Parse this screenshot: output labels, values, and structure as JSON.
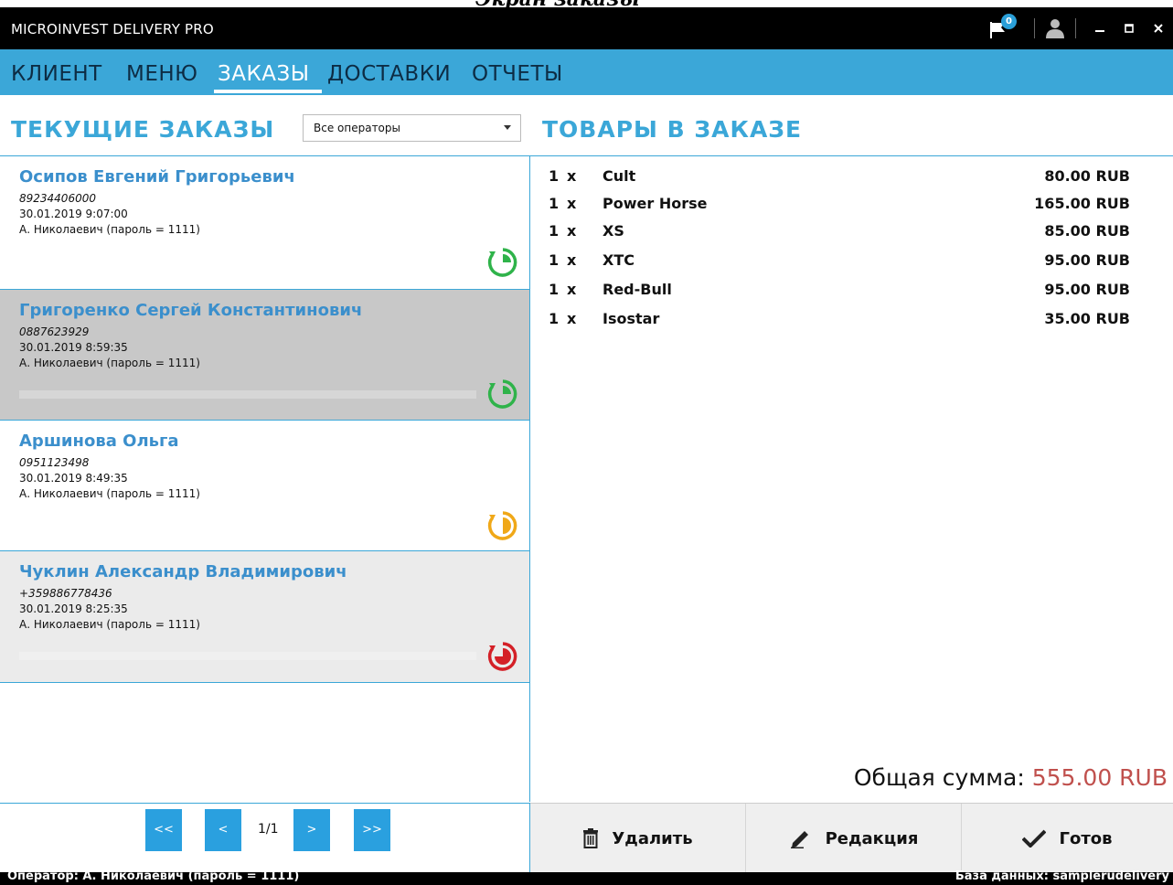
{
  "caption": "Экран заказы",
  "window": {
    "title": "MICROINVEST DELIVERY PRO",
    "notification_count": "0"
  },
  "menu": [
    {
      "label": "КЛИЕНТ",
      "active": false
    },
    {
      "label": "МЕНЮ",
      "active": false
    },
    {
      "label": "ЗАКАЗЫ",
      "active": true
    },
    {
      "label": "ДОСТАВКИ",
      "active": false
    },
    {
      "label": "ОТЧЕТЫ",
      "active": false
    }
  ],
  "orders_section": {
    "title": "ТЕКУЩИЕ ЗАКАЗЫ",
    "operator_filter": "Все операторы"
  },
  "orders": [
    {
      "name": "Осипов Евгений Григорьевич",
      "phone": "89234406000",
      "datetime": "30.01.2019 9:07:00",
      "operator": "А. Николаевич (пароль = 1111)",
      "status_color": "#2fb34a",
      "status_icon": "progress-clock-icon"
    },
    {
      "name": "Григоренко Сергей Константинович",
      "phone": "0887623929",
      "datetime": "30.01.2019 8:59:35",
      "operator": "А. Николаевич (пароль = 1111)",
      "status_color": "#2fb34a",
      "status_icon": "progress-clock-icon"
    },
    {
      "name": "Аршинова Ольга",
      "phone": "0951123498",
      "datetime": "30.01.2019 8:49:35",
      "operator": "А. Николаевич (пароль = 1111)",
      "status_color": "#f0a818",
      "status_icon": "progress-clock-icon"
    },
    {
      "name": "Чуклин Александр Владимирович",
      "phone": "+359886778436",
      "datetime": "30.01.2019 8:25:35",
      "operator": "А. Николаевич (пароль = 1111)",
      "status_color": "#d42027",
      "status_icon": "progress-clock-icon"
    }
  ],
  "items_section": {
    "title": "ТОВАРЫ В ЗАКАЗЕ"
  },
  "items": [
    {
      "qty": "1",
      "x": "x",
      "name": "Cult",
      "price": "80.00 RUB"
    },
    {
      "qty": "1",
      "x": "x",
      "name": "Power Horse",
      "price": "165.00 RUB"
    },
    {
      "qty": "1",
      "x": "x",
      "name": "XS",
      "price": "85.00 RUB"
    },
    {
      "qty": "1",
      "x": "x",
      "name": "XTC",
      "price": "95.00 RUB"
    },
    {
      "qty": "1",
      "x": "x",
      "name": "Red-Bull",
      "price": "95.00 RUB"
    },
    {
      "qty": "1",
      "x": "x",
      "name": "Isostar",
      "price": "35.00 RUB"
    }
  ],
  "total": {
    "label": "Общая сумма: ",
    "amount": "555.00 RUB"
  },
  "pager": {
    "first": "<<",
    "prev": "<",
    "info": "1/1",
    "next": ">",
    "last": ">>"
  },
  "actions": {
    "delete": "Удалить",
    "edit": "Редакция",
    "done": "Готов"
  },
  "statusbar": {
    "operator": "Оператор: А. Николаевич (пароль = 1111)",
    "database": "База данных: samplerudelivery"
  },
  "colors": {
    "accent": "#3ba7d8",
    "name_blue": "#3b8fcc",
    "total_red": "#c0504d",
    "selected_row": "#c8c8c8",
    "alt_row": "#ebebeb"
  }
}
